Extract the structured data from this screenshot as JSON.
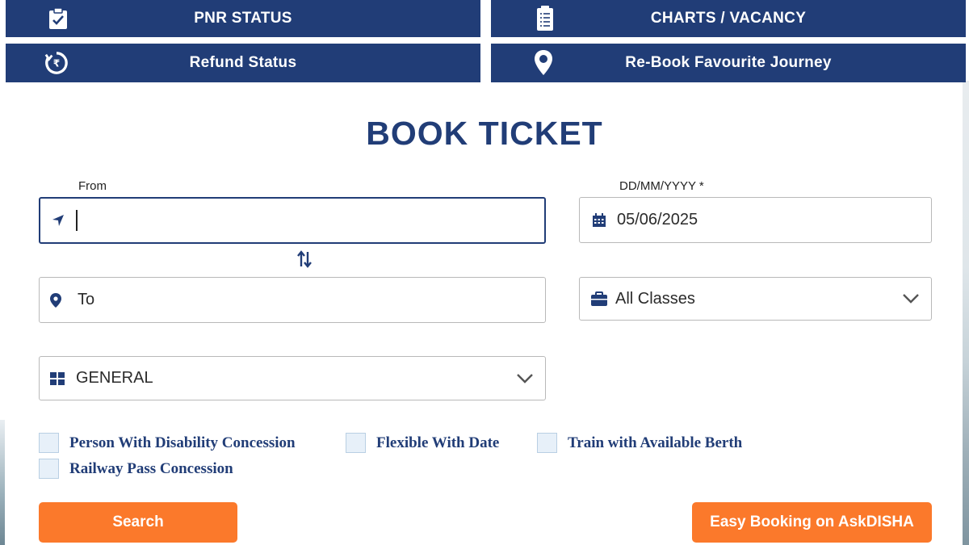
{
  "tiles": {
    "pnr": {
      "label": "PNR STATUS",
      "icon": "clipboard-check-icon"
    },
    "charts": {
      "label": "CHARTS / VACANCY",
      "icon": "list-document-icon"
    },
    "refund": {
      "label": "Refund Status",
      "icon": "rupee-refund-icon"
    },
    "rebook": {
      "label": "Re-Book Favourite Journey",
      "icon": "map-pin-icon"
    }
  },
  "form": {
    "title": "BOOK TICKET",
    "from": {
      "label": "From",
      "value": "",
      "icon": "location-arrow-icon"
    },
    "date": {
      "label": "DD/MM/YYYY *",
      "value": "05/06/2025",
      "icon": "calendar-icon"
    },
    "to": {
      "placeholder": "To",
      "icon": "map-marker-icon"
    },
    "class": {
      "value": "All Classes",
      "icon": "briefcase-icon"
    },
    "quota": {
      "value": "GENERAL",
      "icon": "grid-icon"
    },
    "swap_icon": "swap-arrows-icon"
  },
  "options": {
    "disability": "Person With Disability Concession",
    "flexible": "Flexible With Date",
    "berth": "Train with Available Berth",
    "railway_pass": "Railway Pass Concession"
  },
  "buttons": {
    "search": "Search",
    "askdisha": "Easy Booking on AskDISHA"
  },
  "colors": {
    "primary": "#213d77",
    "accent": "#fb792b",
    "checkbox_bg": "#e7f0f9"
  }
}
